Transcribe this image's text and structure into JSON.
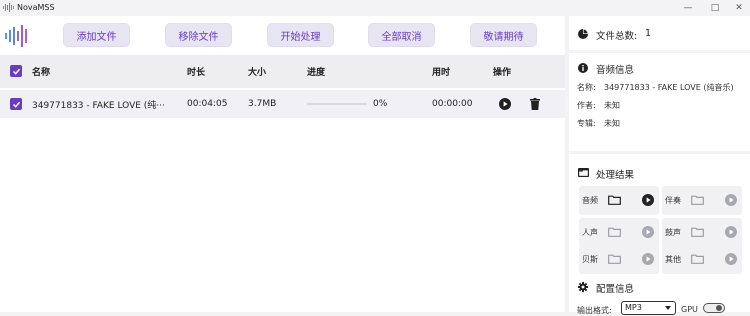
{
  "window": {
    "title": "NovaMSS",
    "controls": {
      "minimize": "—",
      "maximize": "□",
      "close": "✕"
    }
  },
  "colors": {
    "accent": "#6a3cc0",
    "button_bg": "#e8e5f3",
    "header_bg": "#eeeef1",
    "row_bg": "#f0f0f6",
    "icon_muted": "#9c9ca4"
  },
  "toolbar": {
    "buttons": [
      {
        "label": "添加文件"
      },
      {
        "label": "移除文件"
      },
      {
        "label": "开始处理"
      },
      {
        "label": "全部取消"
      },
      {
        "label": "敬请期待"
      }
    ]
  },
  "table": {
    "headers": {
      "name": "名称",
      "duration": "时长",
      "size": "大小",
      "progress": "进度",
      "time": "用时",
      "action": "操作"
    },
    "rows": [
      {
        "name": "349771833 - FAKE LOVE (纯···",
        "duration": "00:04:05",
        "size": "3.7MB",
        "progress_percent": 0,
        "progress_text": "0%",
        "time": "00:00:00",
        "checked": true
      }
    ]
  },
  "sidebar": {
    "file_total": {
      "label": "文件总数:",
      "value": "1"
    },
    "audio_info": {
      "title": "音频信息",
      "name_label": "名称:",
      "name_value": "349771833 - FAKE LOVE (纯音乐)",
      "author_label": "作者:",
      "author_value": "未知",
      "album_label": "专辑:",
      "album_value": "未知"
    },
    "results": {
      "title": "处理结果",
      "items": [
        {
          "label": "音频",
          "active": true
        },
        {
          "label": "伴奏",
          "active": false
        },
        {
          "label": "人声",
          "active": false
        },
        {
          "label": "鼓声",
          "active": false
        },
        {
          "label": "贝斯",
          "active": false
        },
        {
          "label": "其他",
          "active": false
        }
      ]
    },
    "config": {
      "title": "配置信息",
      "format_label": "输出格式:",
      "format_value": "MP3",
      "gpu_label": "GPU",
      "gpu_enabled": true
    }
  }
}
